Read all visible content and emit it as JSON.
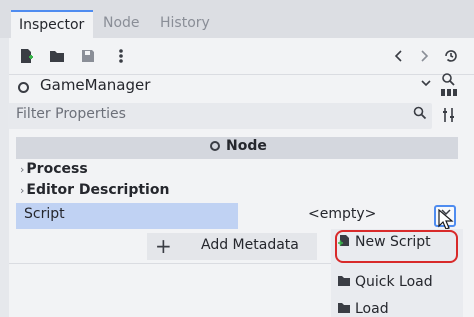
{
  "tabs": [
    {
      "label": "Inspector",
      "active": true
    },
    {
      "label": "Node",
      "active": false
    },
    {
      "label": "History",
      "active": false
    }
  ],
  "toolbar": {
    "icons": [
      "new-resource-icon",
      "open-folder-icon",
      "save-icon",
      "more-vertical-icon",
      "back-icon",
      "forward-icon",
      "history-icon"
    ]
  },
  "object": {
    "name": "GameManager",
    "icon": "node-circle-icon"
  },
  "filter": {
    "placeholder": "Filter Properties"
  },
  "inspector": {
    "node_header": "Node",
    "sections": [
      "Process",
      "Editor Description"
    ],
    "script_label": "Script",
    "script_value": "<empty>",
    "add_metadata": "Add Metadata"
  },
  "dropdown_menu": {
    "items": [
      "New Script",
      "Quick Load",
      "Load"
    ],
    "highlight_color": "#d82a2a"
  },
  "colors": {
    "accent": "#4f8cf0",
    "property_highlight": "#c0d2f3"
  }
}
